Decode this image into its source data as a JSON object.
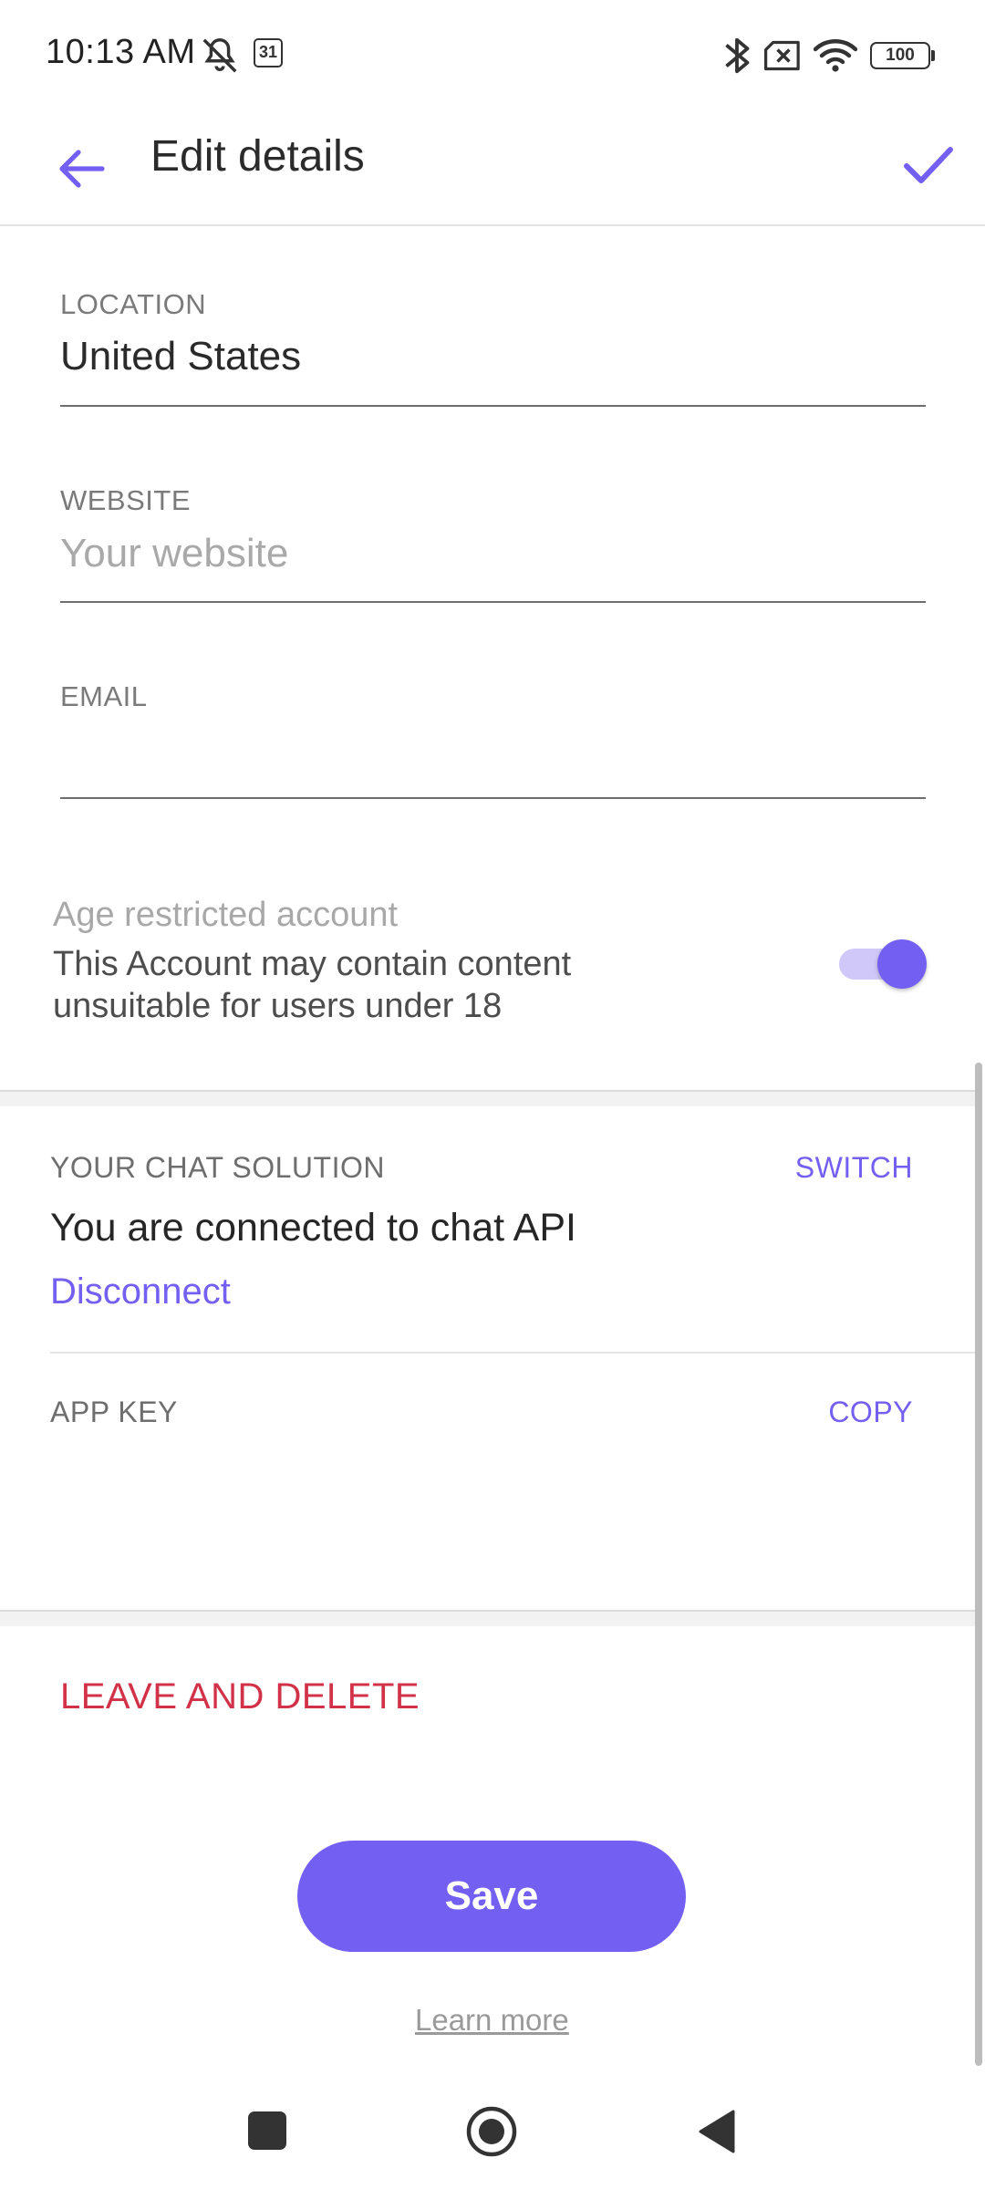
{
  "status_bar": {
    "time": "10:13 AM",
    "calendar_day": "31",
    "battery": "100",
    "icons": [
      "notifications-off-icon",
      "calendar-icon",
      "bluetooth-icon",
      "no-sim-icon",
      "wifi-icon",
      "battery-icon"
    ]
  },
  "app_bar": {
    "title": "Edit details",
    "back_icon": "arrow-back-icon",
    "confirm_icon": "check-icon"
  },
  "form": {
    "location": {
      "label": "LOCATION",
      "value": "United States"
    },
    "website": {
      "label": "WEBSITE",
      "placeholder": "Your website"
    },
    "email": {
      "label": "EMAIL",
      "value": ""
    }
  },
  "age_restricted": {
    "title": "Age restricted account",
    "description_line1": "This Account may contain content",
    "description_line2": "unsuitable for users under 18",
    "enabled": true
  },
  "chat_solution": {
    "label": "YOUR CHAT SOLUTION",
    "action": "SWITCH",
    "status": "You are connected to chat API",
    "disconnect": "Disconnect"
  },
  "app_key": {
    "label": "APP KEY",
    "action": "COPY"
  },
  "leave_delete": "LEAVE AND DELETE",
  "save_button": "Save",
  "learn_more": "Learn more",
  "colors": {
    "accent": "#7360f2",
    "danger": "#d23248",
    "toggle_track": "#cfc8f8"
  },
  "nav_bar": {
    "icons": [
      "recents-square-icon",
      "home-circle-icon",
      "back-triangle-icon"
    ]
  }
}
